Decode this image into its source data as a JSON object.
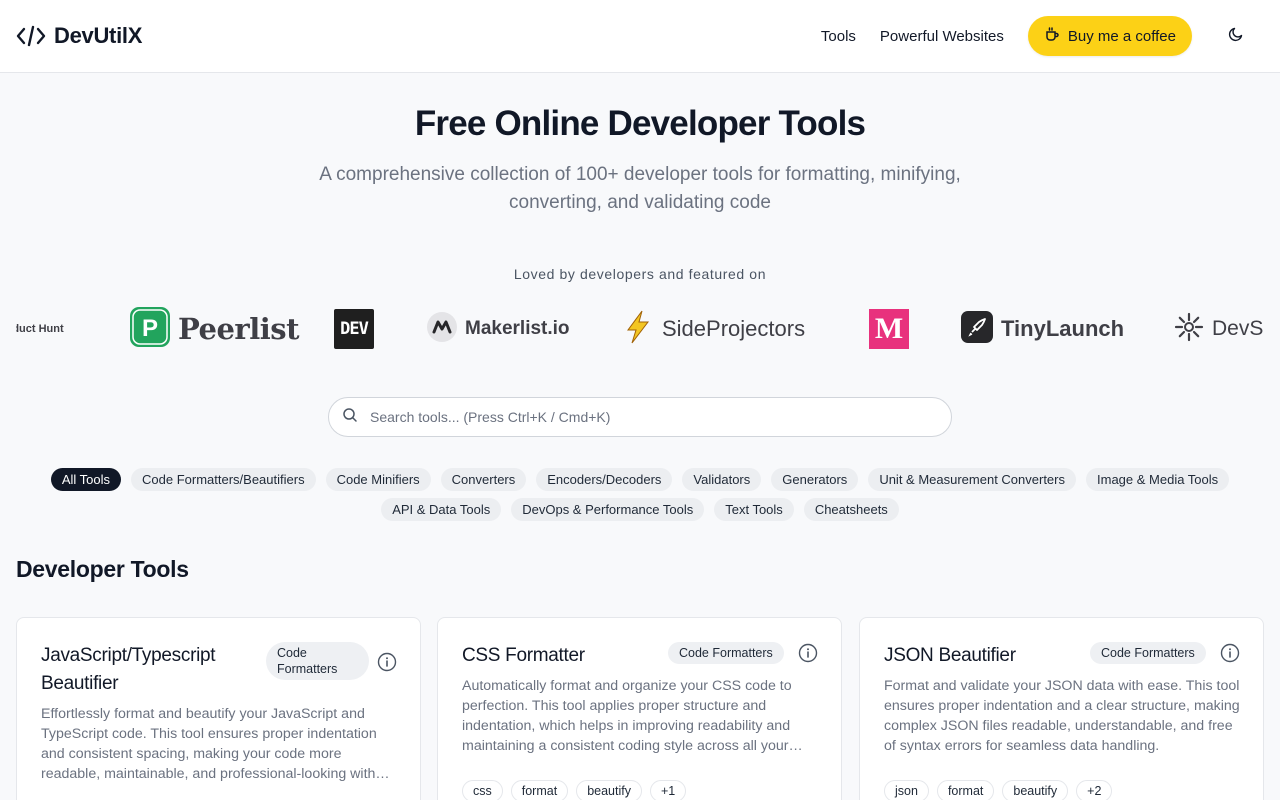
{
  "header": {
    "brand": "DevUtilX",
    "nav": [
      "Tools",
      "Powerful Websites"
    ],
    "coffee_label": "Buy me a coffee"
  },
  "hero": {
    "title": "Free Online Developer Tools",
    "subtitle": "A comprehensive collection of 100+ developer tools for formatting, minifying, converting, and validating code"
  },
  "featured": {
    "label": "Loved by developers and featured on",
    "logos": [
      "Product Hunt",
      "Peerlist",
      "DEV",
      "Makerlist.io",
      "SideProjectors",
      "M",
      "TinyLaunch",
      "DevSo"
    ]
  },
  "search": {
    "placeholder": "Search tools... (Press Ctrl+K / Cmd+K)"
  },
  "categories": {
    "row1": [
      "All Tools",
      "Code Formatters/Beautifiers",
      "Code Minifiers",
      "Converters",
      "Encoders/Decoders",
      "Validators",
      "Generators",
      "Unit & Measurement Converters",
      "Image & Media Tools"
    ],
    "row2": [
      "API & Data Tools",
      "DevOps & Performance Tools",
      "Text Tools",
      "Cheatsheets"
    ],
    "active": "All Tools"
  },
  "section_title": "Developer Tools",
  "cards": [
    {
      "title": "JavaScript/Typescript Beautifier",
      "category": "Code Formatters",
      "description": "Effortlessly format and beautify your JavaScript and TypeScript code. This tool ensures proper indentation and consistent spacing, making your code more readable, maintainable, and professional-looking with minimal effort.",
      "tags": []
    },
    {
      "title": "CSS Formatter",
      "category": "Code Formatters",
      "description": "Automatically format and organize your CSS code to perfection. This tool applies proper structure and indentation, which helps in improving readability and maintaining a consistent coding style across all your projects.",
      "tags": [
        "css",
        "format",
        "beautify",
        "+1"
      ]
    },
    {
      "title": "JSON Beautifier",
      "category": "Code Formatters",
      "description": "Format and validate your JSON data with ease. This tool ensures proper indentation and a clear structure, making complex JSON files readable, understandable, and free of syntax errors for seamless data handling.",
      "tags": [
        "json",
        "format",
        "beautify",
        "+2"
      ]
    }
  ],
  "colors": {
    "accent": "#fcd116",
    "active_chip": "#111827",
    "peerlist_green": "#22a45d",
    "magenta": "#e8317d"
  }
}
